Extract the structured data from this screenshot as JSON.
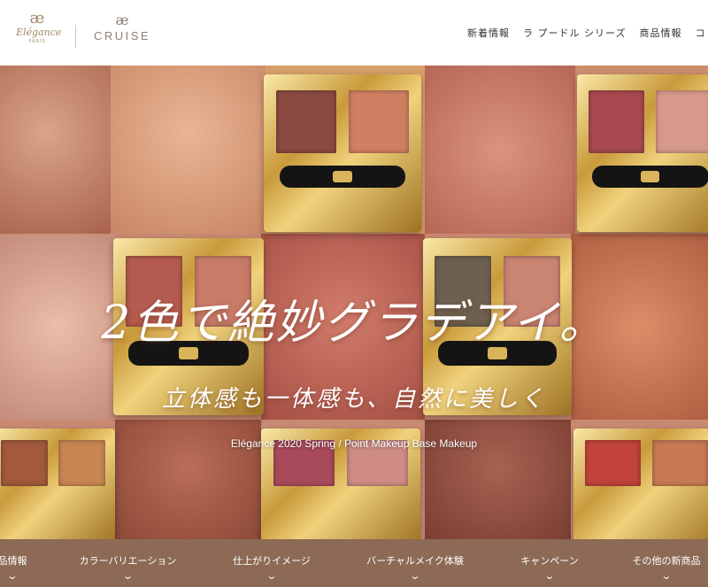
{
  "header": {
    "logo_elegance": {
      "mark": "æ",
      "word": "Elégance",
      "sub": "PARIS"
    },
    "logo_cruise": {
      "mark": "æ",
      "word": "CRUISE"
    },
    "nav": [
      "新着情報",
      "ラ プードル シリーズ",
      "商品情報",
      "コレ"
    ]
  },
  "hero": {
    "headline": "2色で絶妙グラデアイ。",
    "subline": "立体感も一体感も、自然に美しく",
    "tagline": "Elégance 2020 Spring / Point Makeup Base Makeup"
  },
  "bottom_nav": {
    "items": [
      "品情報",
      "カラーバリエーション",
      "仕上がりイメージ",
      "バーチャルメイク体験",
      "キャンペーン",
      "その他の新商品"
    ],
    "chevron": "⌄"
  },
  "colors": {
    "bottom_nav_bg": "#8c6a56",
    "gold": "#c99a3b"
  }
}
